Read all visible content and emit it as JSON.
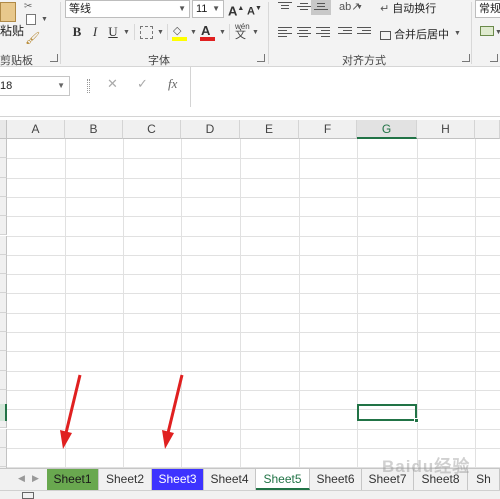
{
  "ribbon": {
    "paste_label": "粘贴",
    "clipboard_label": "剪贴板",
    "font_group_label": "字体",
    "align_group_label": "对齐方式",
    "font_name": "等线",
    "font_size": "11",
    "wrap_text": "自动换行",
    "merge_center": "合并后居中",
    "number_format": "常规",
    "bold": "B",
    "italic": "I",
    "underline": "U",
    "increase_font": "A",
    "decrease_font": "A",
    "font_color_letter": "A",
    "wen_label": "wén"
  },
  "formula_bar": {
    "name_box": "18",
    "fx": "fx"
  },
  "grid": {
    "columns": [
      "A",
      "B",
      "C",
      "D",
      "E",
      "F",
      "G",
      "H"
    ],
    "active_column": "G"
  },
  "sheets": [
    {
      "label": "Sheet1",
      "style": "green"
    },
    {
      "label": "Sheet2",
      "style": "normal"
    },
    {
      "label": "Sheet3",
      "style": "blue"
    },
    {
      "label": "Sheet4",
      "style": "normal"
    },
    {
      "label": "Sheet5",
      "style": "active"
    },
    {
      "label": "Sheet6",
      "style": "normal"
    },
    {
      "label": "Sheet7",
      "style": "normal"
    },
    {
      "label": "Sheet8",
      "style": "normal"
    },
    {
      "label": "Sh",
      "style": "normal"
    }
  ],
  "watermark": "Baidu经验",
  "colors": {
    "excel_green": "#217346",
    "sheet1_tab": "#69a84f",
    "sheet3_tab": "#3d33ff",
    "annotation_arrow": "#e02020"
  }
}
